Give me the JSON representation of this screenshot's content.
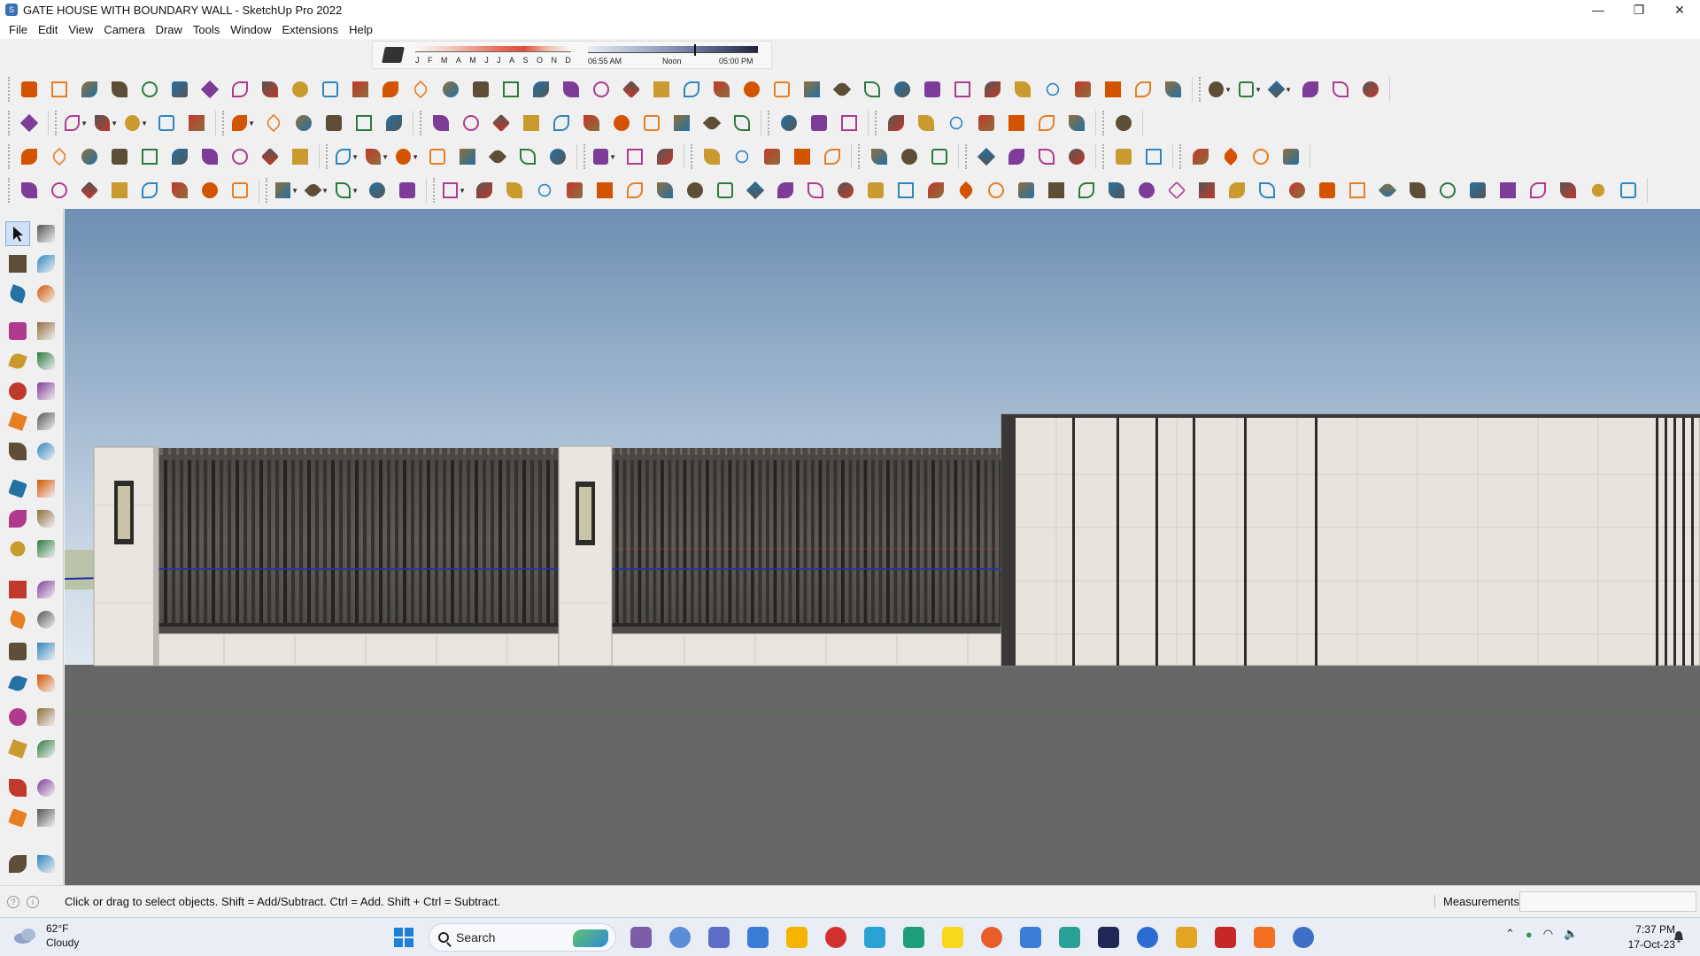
{
  "window": {
    "title": "GATE HOUSE WITH BOUNDARY WALL - SketchUp Pro 2022"
  },
  "window_controls": {
    "minimize": "—",
    "maximize": "❐",
    "close": "✕"
  },
  "menu": [
    "File",
    "Edit",
    "View",
    "Camera",
    "Draw",
    "Tools",
    "Window",
    "Extensions",
    "Help"
  ],
  "shadows": {
    "months": [
      "J",
      "F",
      "M",
      "A",
      "M",
      "J",
      "J",
      "A",
      "S",
      "O",
      "N",
      "D"
    ],
    "time_start": "06:55 AM",
    "time_mid": "Noon",
    "time_end": "05:00 PM"
  },
  "status": {
    "hint": "Click or drag to select objects. Shift = Add/Subtract. Ctrl = Add. Shift + Ctrl = Subtract.",
    "measurements_label": "Measurements",
    "measurements_value": ""
  },
  "taskbar": {
    "weather_temp": "62°F",
    "weather_desc": "Cloudy",
    "search_label": "Search",
    "time": "7:37 PM",
    "date": "17-Oct-23"
  },
  "colors": {
    "sky_top": "#6d8fb3",
    "sky_bottom": "#d9e5ef",
    "ground": "#666666",
    "stone": "#e7e4de",
    "grille": "#3a3836",
    "accent_selection": "#cfe0f7"
  }
}
